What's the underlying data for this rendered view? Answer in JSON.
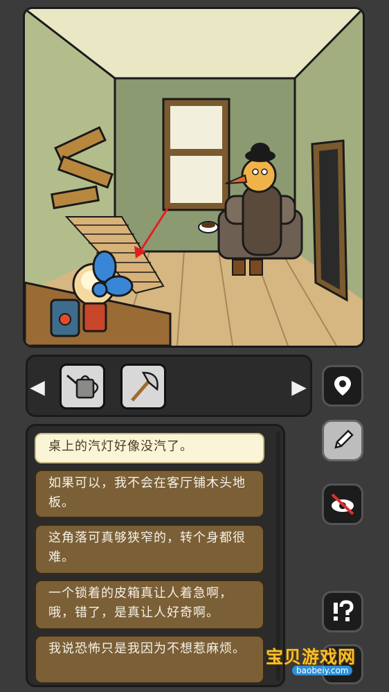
{
  "inventory": {
    "left_arrow": "◀",
    "right_arrow": "▶",
    "items": [
      {
        "name": "watering-can",
        "icon": "watering-can-icon"
      },
      {
        "name": "axe",
        "icon": "axe-icon"
      }
    ]
  },
  "side_buttons": {
    "map": "map-pin-icon",
    "notes": "pencil-icon",
    "hide": "eye-crossed-icon",
    "hint": "hint-icon"
  },
  "dialog": {
    "options": [
      {
        "text": "桌上的汽灯好像没汽了。",
        "selected": true
      },
      {
        "text": "如果可以，我不会在客厅铺木头地板。",
        "selected": false
      },
      {
        "text": "这角落可真够狭窄的，转个身都很难。",
        "selected": false
      },
      {
        "text": "一个锁着的皮箱真让人着急啊，哦，错了，是真让人好奇啊。",
        "selected": false
      },
      {
        "text": "我说恐怖只是我因为不想惹麻烦。",
        "selected": false
      }
    ]
  },
  "watermark": {
    "text": "宝贝游戏网",
    "url": "baobeiy.com"
  },
  "colors": {
    "background": "#3b3b3b",
    "option_bg": "#7a5f37",
    "option_selected_bg": "#fbf5d8"
  }
}
